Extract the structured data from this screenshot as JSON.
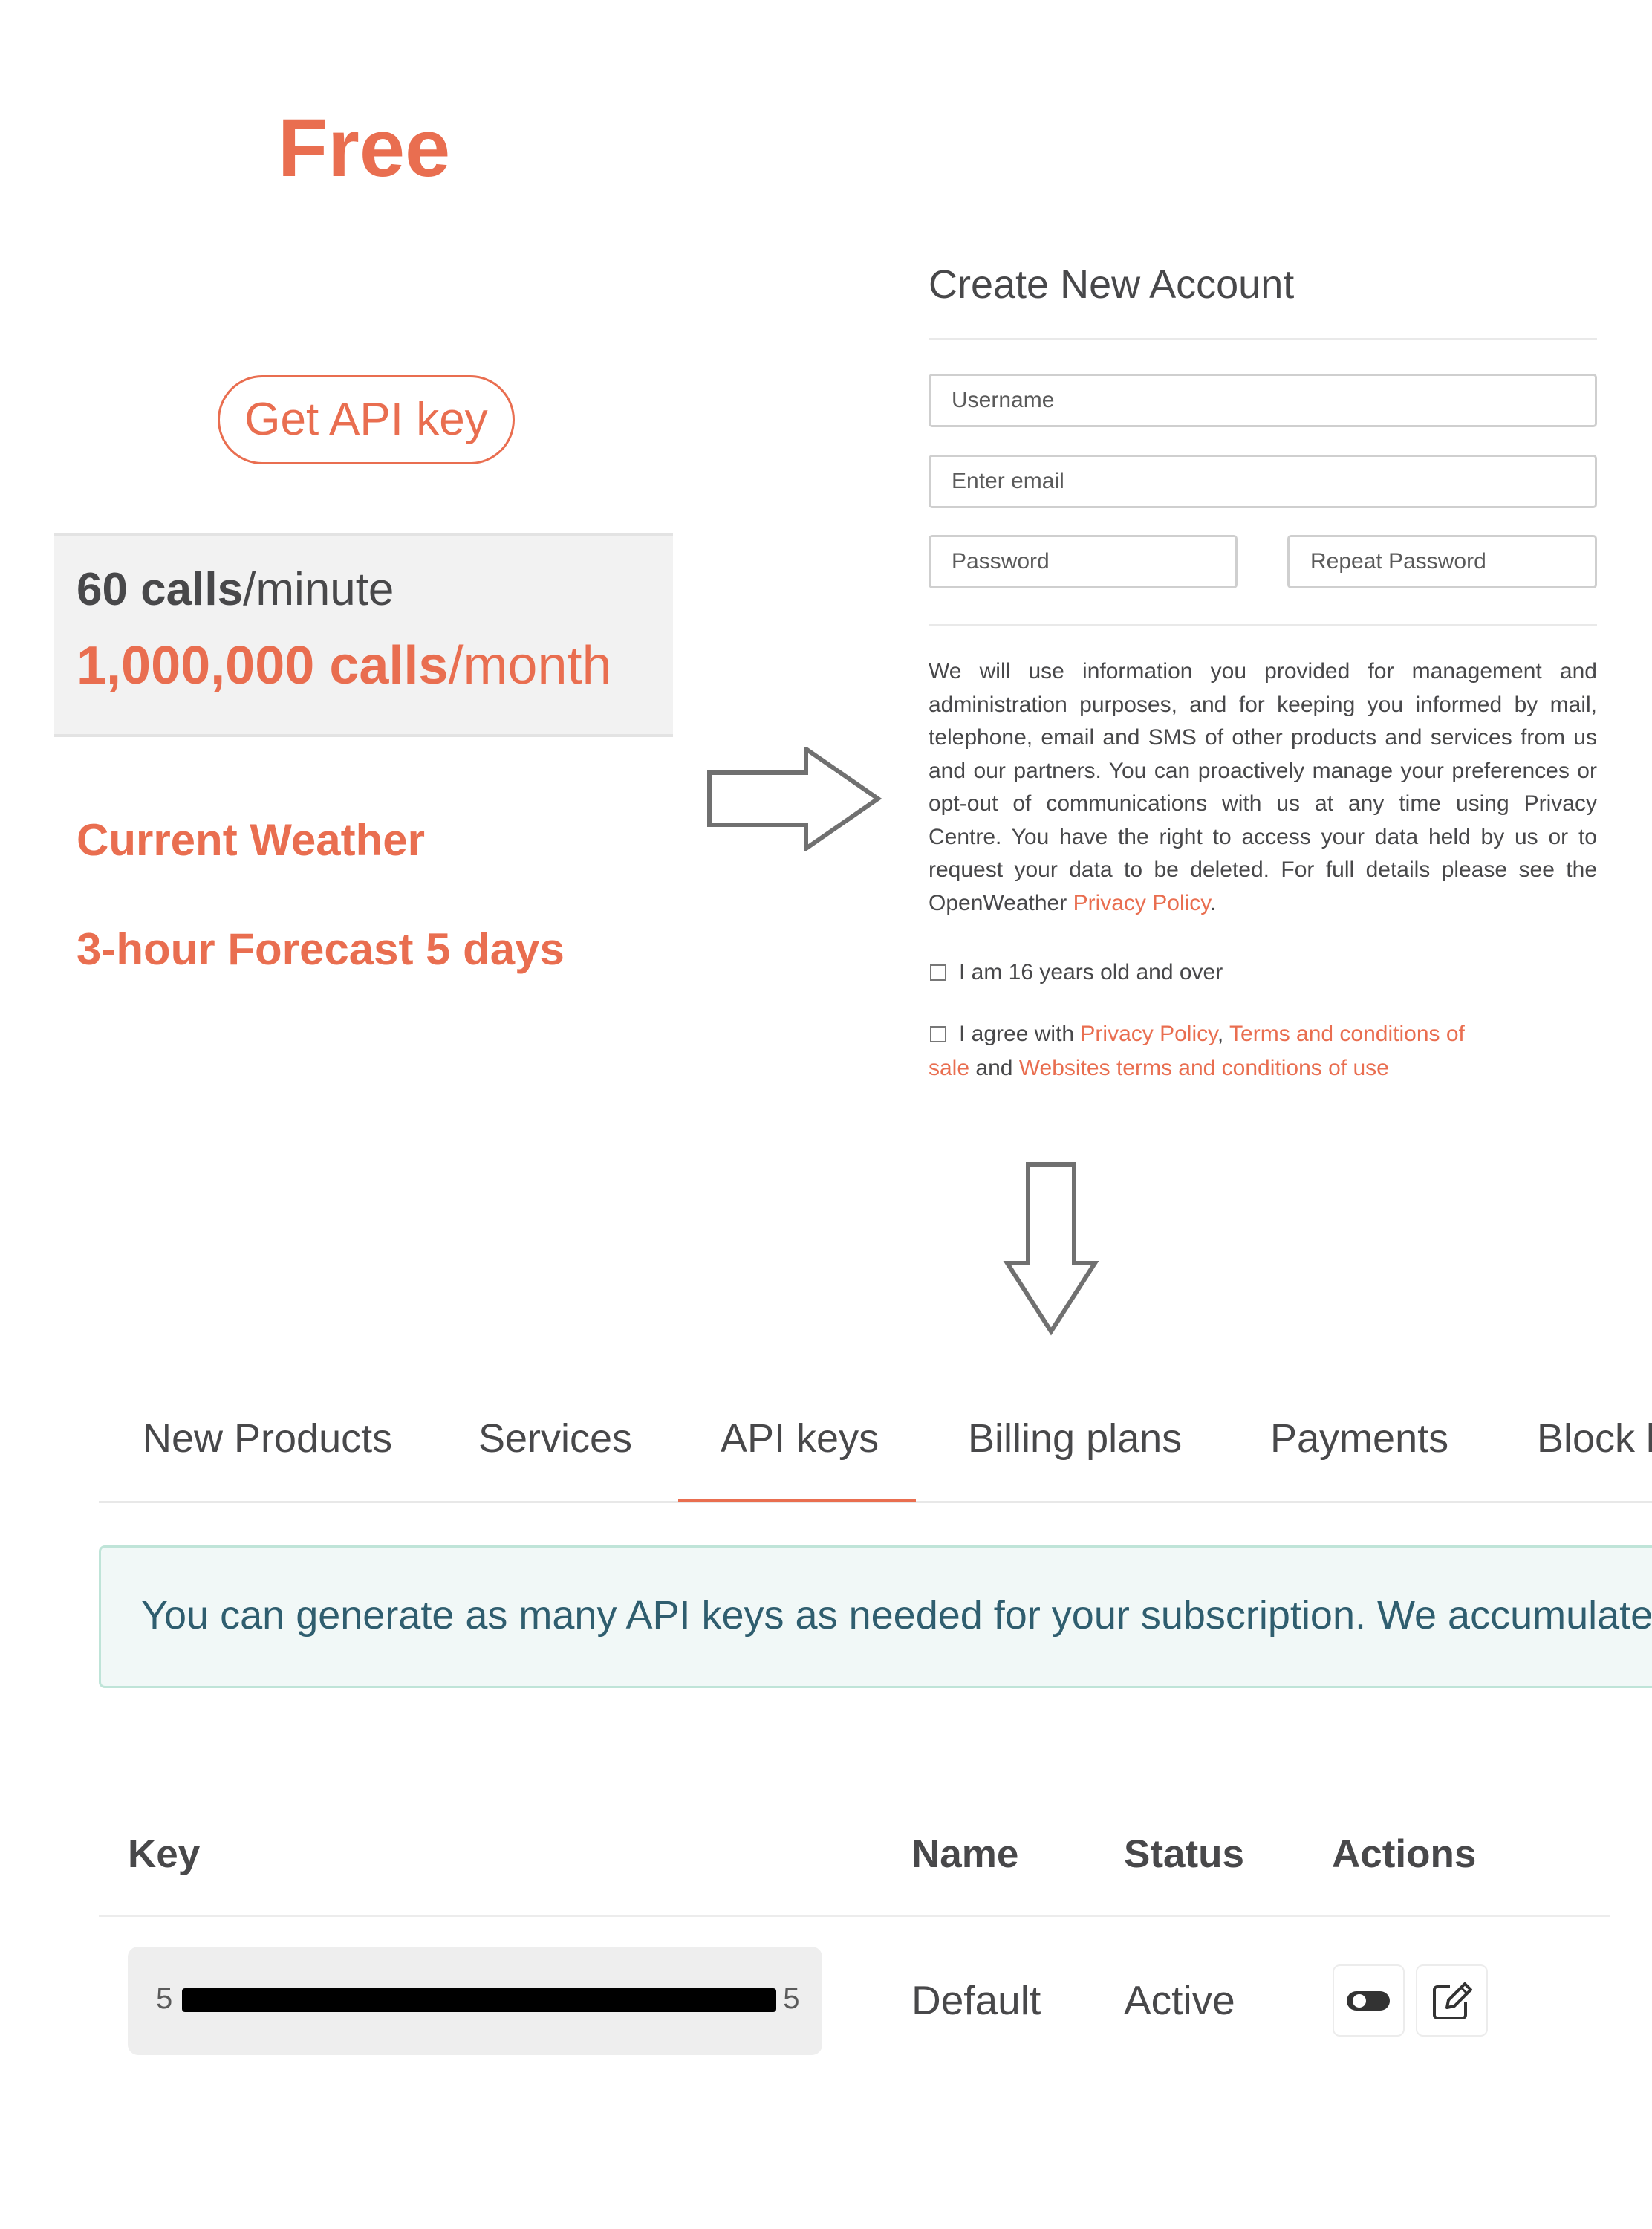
{
  "plan": {
    "title": "Free",
    "button": "Get API key",
    "calls_minute_value": "60 calls",
    "calls_minute_unit": "/minute",
    "calls_month_value": "1,000,000 calls",
    "calls_month_unit": "/month",
    "features": [
      "Current Weather",
      "3-hour Forecast 5 days"
    ]
  },
  "form": {
    "title": "Create New Account",
    "username_placeholder": "Username",
    "email_placeholder": "Enter email",
    "password_placeholder": "Password",
    "repeat_password_placeholder": "Repeat Password",
    "policy_text": "We will use information you provided for management and administration purposes, and for keeping you informed by mail, telephone, email and SMS of other products and services from us and our partners. You can proactively manage your preferences or opt-out of communications with us at any time using Privacy Centre. You have the right to access your data held by us or to request your data to be deleted. For full details please see the OpenWeather ",
    "policy_link": "Privacy Policy",
    "policy_end": ".",
    "age_check_label": "I am 16 years old and over",
    "agree_prefix": "I agree with ",
    "agree_link_privacy": "Privacy Policy",
    "agree_comma": ", ",
    "agree_link_terms_1": "Terms and conditions of",
    "agree_link_terms_2": "sale",
    "agree_and": " and ",
    "agree_link_websites": "Websites terms and conditions of use"
  },
  "tabs": [
    "New Products",
    "Services",
    "API keys",
    "Billing plans",
    "Payments",
    "Block l"
  ],
  "active_tab": "API keys",
  "info_alert": "You can generate as many API keys as needed for your subscription. We accumulate th",
  "table": {
    "headers": {
      "key": "Key",
      "name": "Name",
      "status": "Status",
      "actions": "Actions"
    },
    "row": {
      "key_start": "5",
      "key_end": "5",
      "name": "Default",
      "status": "Active"
    }
  },
  "icons": {
    "arrow_right": "arrow-right-outline-icon",
    "arrow_down": "arrow-down-outline-icon",
    "toggle": "toggle-icon",
    "edit": "edit-icon"
  },
  "colors": {
    "accent": "#e96e50",
    "text": "#48484a",
    "alert_bg": "#f1f8f7",
    "alert_border": "#bfe4d8"
  }
}
